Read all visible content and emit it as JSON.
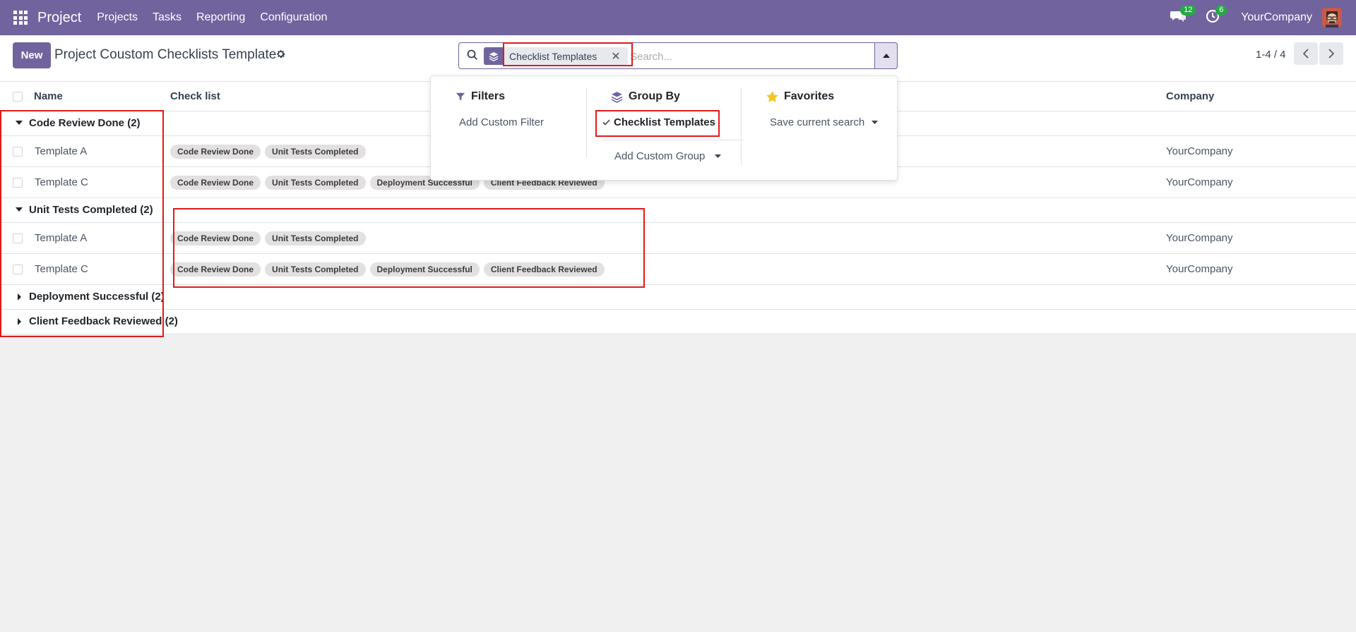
{
  "navbar": {
    "brand": "Project",
    "menu": [
      "Projects",
      "Tasks",
      "Reporting",
      "Configuration"
    ],
    "messages_count": "12",
    "activities_count": "6",
    "company": "YourCompany"
  },
  "control": {
    "new_label": "New",
    "title": "Project Coustom Checklists Template",
    "facet_label": "Checklist Templates",
    "search_placeholder": "Search...",
    "pager": "1-4 / 4"
  },
  "table": {
    "headers": {
      "name": "Name",
      "checklist": "Check list",
      "company": "Company"
    },
    "groups": [
      {
        "label": "Code Review Done (2)",
        "expanded": true,
        "rows": [
          {
            "name": "Template A",
            "tags": [
              "Code Review Done",
              "Unit Tests Completed"
            ],
            "company": "YourCompany"
          },
          {
            "name": "Template C",
            "tags": [
              "Code Review Done",
              "Unit Tests Completed",
              "Deployment Successful",
              "Client Feedback Reviewed"
            ],
            "company": "YourCompany"
          }
        ]
      },
      {
        "label": "Unit Tests Completed (2)",
        "expanded": true,
        "rows": [
          {
            "name": "Template A",
            "tags": [
              "Code Review Done",
              "Unit Tests Completed"
            ],
            "company": "YourCompany"
          },
          {
            "name": "Template C",
            "tags": [
              "Code Review Done",
              "Unit Tests Completed",
              "Deployment Successful",
              "Client Feedback Reviewed"
            ],
            "company": "YourCompany"
          }
        ]
      },
      {
        "label": "Deployment Successful (2)",
        "expanded": false,
        "rows": []
      },
      {
        "label": "Client Feedback Reviewed (2)",
        "expanded": false,
        "rows": []
      }
    ]
  },
  "dropdown": {
    "filters_title": "Filters",
    "add_custom_filter": "Add Custom Filter",
    "groupby_title": "Group By",
    "groupby_selected": "Checklist Templates",
    "add_custom_group": "Add Custom Group",
    "favorites_title": "Favorites",
    "save_current_search": "Save current search"
  },
  "colors": {
    "brand": "#71639e",
    "highlight": "#e21a1a",
    "badge": "#28a745"
  }
}
